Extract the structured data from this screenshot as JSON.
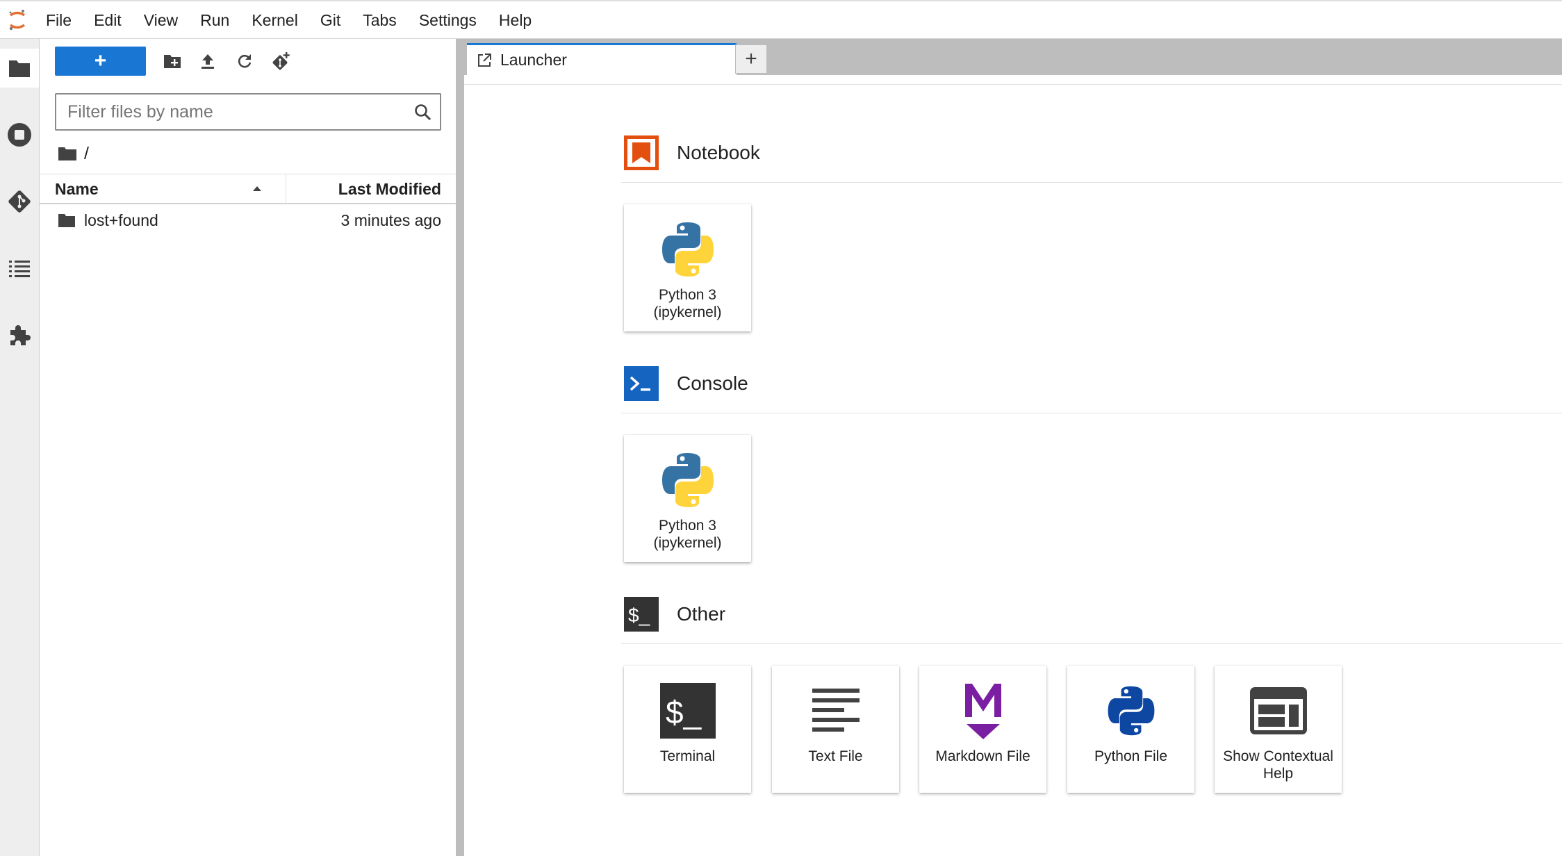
{
  "menubar": {
    "items": [
      "File",
      "Edit",
      "View",
      "Run",
      "Kernel",
      "Git",
      "Tabs",
      "Settings",
      "Help"
    ]
  },
  "activitybar": {
    "icons": [
      "folder-icon",
      "running-icon",
      "git-icon",
      "toc-icon",
      "extension-icon"
    ]
  },
  "filebrowser": {
    "new_label": "+",
    "filter_placeholder": "Filter files by name",
    "breadcrumb": "/",
    "columns": {
      "name": "Name",
      "modified": "Last Modified"
    },
    "files": [
      {
        "name": "lost+found",
        "modified": "3 minutes ago",
        "icon": "folder-icon"
      }
    ]
  },
  "tabs": [
    {
      "label": "Launcher",
      "icon": "launcher-icon"
    }
  ],
  "tab_add_label": "+",
  "launcher": {
    "sections": {
      "notebook": {
        "title": "Notebook"
      },
      "console": {
        "title": "Console"
      },
      "other": {
        "title": "Other"
      }
    },
    "notebook_cards": [
      {
        "label": "Python 3 (ipykernel)"
      }
    ],
    "console_cards": [
      {
        "label": "Python 3 (ipykernel)"
      }
    ],
    "other_cards": [
      {
        "label": "Terminal"
      },
      {
        "label": "Text File"
      },
      {
        "label": "Markdown File"
      },
      {
        "label": "Python File"
      },
      {
        "label": "Show Contextual Help"
      }
    ]
  },
  "colors": {
    "accent": "#1976d2",
    "notebook": "#e34f0e",
    "console": "#1565c0",
    "markdown": "#7b1fa2"
  }
}
